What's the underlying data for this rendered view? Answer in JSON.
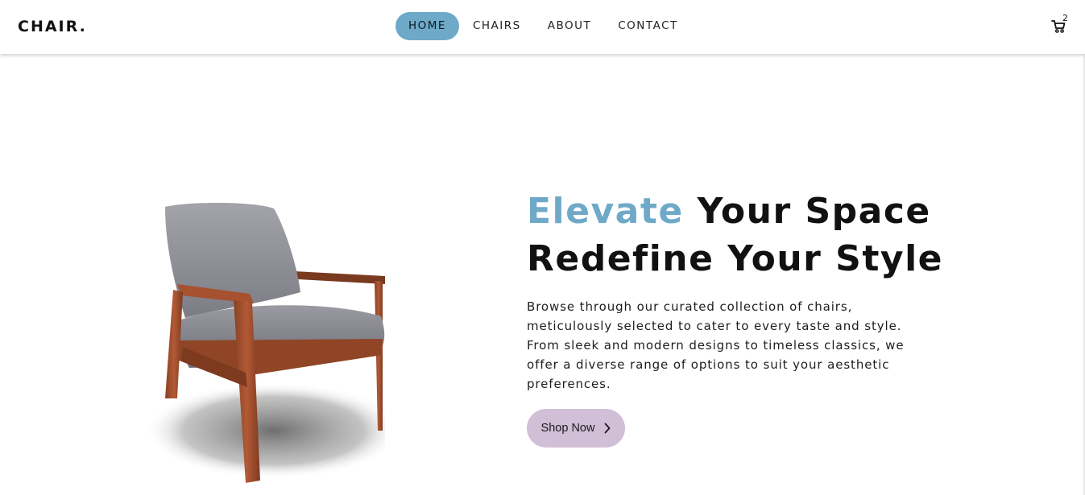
{
  "brand": {
    "logo": "CHAIR."
  },
  "nav": {
    "items": [
      {
        "label": "HOME",
        "active": true
      },
      {
        "label": "CHAIRS",
        "active": false
      },
      {
        "label": "ABOUT",
        "active": false
      },
      {
        "label": "CONTACT",
        "active": false
      }
    ]
  },
  "cart": {
    "icon": "cart-icon",
    "count": "2"
  },
  "hero": {
    "headline_accent": "Elevate",
    "headline_rest_line1": "Your Space",
    "headline_line2": "Redefine Your Style",
    "description": "Browse through our curated collection of chairs, meticulously selected to cater to every taste and style. From sleek and modern designs to timeless classics, we offer a diverse range of options to suit your aesthetic preferences.",
    "cta_label": "Shop Now",
    "cta_icon": "chevron-right-icon"
  },
  "colors": {
    "accent": "#6fa9c8",
    "cta_background": "#d0bfd7",
    "text": "#111111"
  }
}
